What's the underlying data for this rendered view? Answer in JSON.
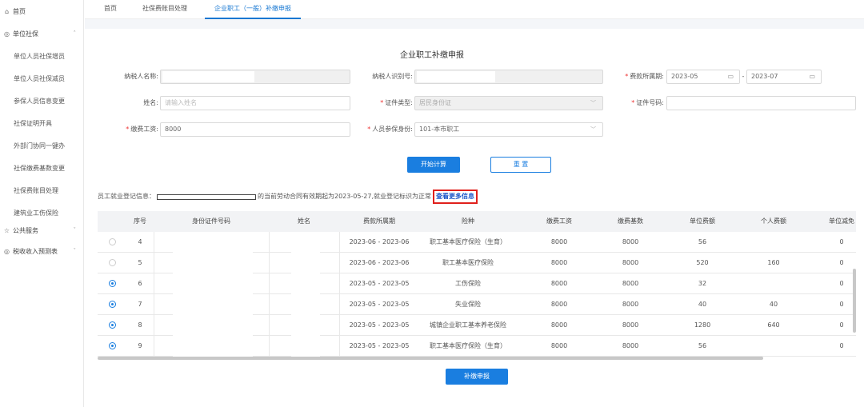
{
  "sidebar": {
    "items": [
      {
        "label": "首页",
        "icon": "⌂",
        "type": "top"
      },
      {
        "label": "单位社保",
        "icon": "◎",
        "type": "top",
        "arrow": "ˆ"
      },
      {
        "label": "单位人员社保增员",
        "type": "sub"
      },
      {
        "label": "单位人员社保减员",
        "type": "sub"
      },
      {
        "label": "参保人员信息变更",
        "type": "sub"
      },
      {
        "label": "社保证明开具",
        "type": "sub"
      },
      {
        "label": "外部门协同一键办",
        "type": "sub"
      },
      {
        "label": "社保缴费基数变更",
        "type": "sub"
      },
      {
        "label": "社保费账目处理",
        "type": "sub"
      },
      {
        "label": "建筑业工伤保险",
        "type": "sub"
      },
      {
        "label": "公共服务",
        "icon": "☆",
        "type": "top",
        "arrow": "ˇ"
      },
      {
        "label": "税收收入预测表",
        "icon": "◎",
        "type": "top",
        "arrow": "ˇ"
      }
    ]
  },
  "tabs": [
    "首页",
    "社保费账目处理",
    "企业职工（一般）补缴申报"
  ],
  "form": {
    "title": "企业职工补缴申报",
    "taxpayer_name_label": "纳税人名称:",
    "taxpayer_id_label": "纳税人识别号:",
    "period_label": "费款所属期:",
    "period_start": "2023-05",
    "period_sep": "-",
    "period_end": "2023-07",
    "name_label": "姓名:",
    "name_placeholder": "请输入姓名",
    "id_type_label": "证件类型:",
    "id_type_value": "居民身份证",
    "id_no_label": "证件号码:",
    "wage_label": "缴费工资:",
    "wage_value": "8000",
    "identity_label": "人员参保身份:",
    "identity_value": "101-本市职工",
    "calc_button": "开始计算",
    "reset_button": "重 置"
  },
  "info": {
    "prefix": "员工就业登记信息：",
    "suffix": "的当前劳动合同有效期起为2023-05-27,就业登记标识为正常",
    "more_link": "查看更多信息"
  },
  "table": {
    "headers": [
      "序号",
      "身份证件号码",
      "姓名",
      "费款所属期",
      "险种",
      "缴费工资",
      "缴费基数",
      "单位费额",
      "个人费额",
      "单位减免"
    ],
    "rows": [
      {
        "checked": false,
        "no": "4",
        "period": "2023-06 - 2023-06",
        "type": "职工基本医疗保险（生育）",
        "wage": "8000",
        "base": "8000",
        "unit_fee": "56",
        "personal_fee": "",
        "reduction": "0"
      },
      {
        "checked": false,
        "no": "5",
        "period": "2023-06 - 2023-06",
        "type": "职工基本医疗保险",
        "wage": "8000",
        "base": "8000",
        "unit_fee": "520",
        "personal_fee": "160",
        "reduction": "0"
      },
      {
        "checked": true,
        "no": "6",
        "period": "2023-05 - 2023-05",
        "type": "工伤保险",
        "wage": "8000",
        "base": "8000",
        "unit_fee": "32",
        "personal_fee": "",
        "reduction": "0"
      },
      {
        "checked": true,
        "no": "7",
        "period": "2023-05 - 2023-05",
        "type": "失业保险",
        "wage": "8000",
        "base": "8000",
        "unit_fee": "40",
        "personal_fee": "40",
        "reduction": "0"
      },
      {
        "checked": true,
        "no": "8",
        "period": "2023-05 - 2023-05",
        "type": "城镇企业职工基本养老保险",
        "wage": "8000",
        "base": "8000",
        "unit_fee": "1280",
        "personal_fee": "640",
        "reduction": "0"
      },
      {
        "checked": true,
        "no": "9",
        "period": "2023-05 - 2023-05",
        "type": "职工基本医疗保险（生育）",
        "wage": "8000",
        "base": "8000",
        "unit_fee": "56",
        "personal_fee": "",
        "reduction": "0"
      }
    ]
  },
  "submit_button": "补缴申报",
  "colors": {
    "accent": "#1a7ee0",
    "highlight_border": "#e0201c",
    "required": "#ee3333"
  }
}
